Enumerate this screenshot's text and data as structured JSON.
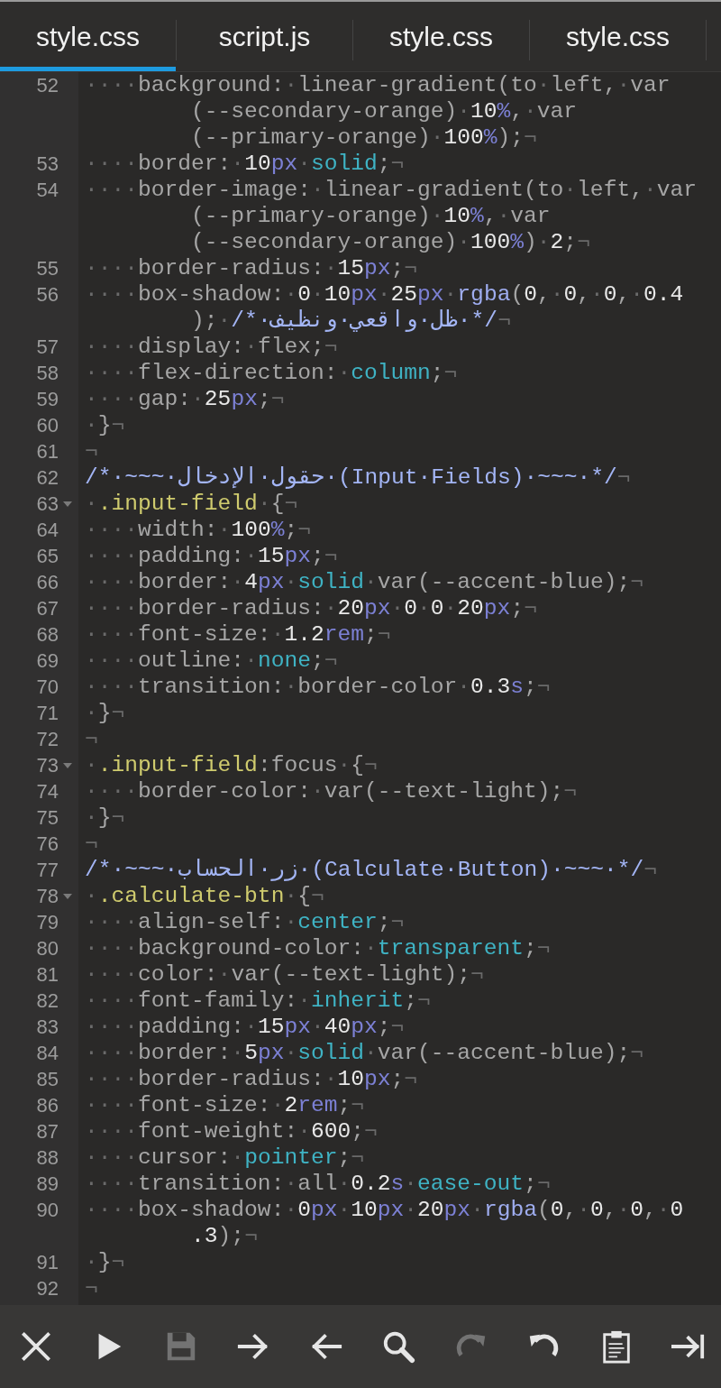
{
  "tabs": [
    {
      "label": "style.css",
      "selected": true
    },
    {
      "label": "script.js",
      "selected": false
    },
    {
      "label": "style.css",
      "selected": false
    },
    {
      "label": "style.css",
      "selected": false
    }
  ],
  "lines": [
    {
      "number": "52",
      "fold": false,
      "rows": [
        {
          "tokens": [
            {
              "kind": "ws",
              "text": "····"
            },
            {
              "kind": "p",
              "text": "background:"
            },
            {
              "kind": "ws",
              "text": "·"
            },
            {
              "kind": "p",
              "text": "linear-gradient(to"
            },
            {
              "kind": "ws",
              "text": "·"
            },
            {
              "kind": "p",
              "text": "left,"
            },
            {
              "kind": "ws",
              "text": "·"
            },
            {
              "kind": "p",
              "text": "var"
            }
          ]
        },
        {
          "tokens": [
            {
              "kind": "p",
              "text": "(--secondary-orange)"
            },
            {
              "kind": "ws",
              "text": "·"
            },
            {
              "kind": "n",
              "text": "10"
            },
            {
              "kind": "u",
              "text": "%"
            },
            {
              "kind": "p",
              "text": ","
            },
            {
              "kind": "ws",
              "text": "·"
            },
            {
              "kind": "p",
              "text": "var"
            }
          ]
        },
        {
          "tokens": [
            {
              "kind": "p",
              "text": "(--primary-orange)"
            },
            {
              "kind": "ws",
              "text": "·"
            },
            {
              "kind": "n",
              "text": "100"
            },
            {
              "kind": "u",
              "text": "%"
            },
            {
              "kind": "p",
              "text": ");"
            },
            {
              "kind": "ws",
              "text": "¬"
            }
          ]
        }
      ]
    },
    {
      "number": "53",
      "fold": false,
      "rows": [
        {
          "tokens": [
            {
              "kind": "ws",
              "text": "····"
            },
            {
              "kind": "p",
              "text": "border:"
            },
            {
              "kind": "ws",
              "text": "·"
            },
            {
              "kind": "n",
              "text": "10"
            },
            {
              "kind": "u",
              "text": "px"
            },
            {
              "kind": "ws",
              "text": "·"
            },
            {
              "kind": "k",
              "text": "solid"
            },
            {
              "kind": "p",
              "text": ";"
            },
            {
              "kind": "ws",
              "text": "¬"
            }
          ]
        }
      ]
    },
    {
      "number": "54",
      "fold": false,
      "rows": [
        {
          "tokens": [
            {
              "kind": "ws",
              "text": "····"
            },
            {
              "kind": "p",
              "text": "border-image:"
            },
            {
              "kind": "ws",
              "text": "·"
            },
            {
              "kind": "p",
              "text": "linear-gradient(to"
            },
            {
              "kind": "ws",
              "text": "·"
            },
            {
              "kind": "p",
              "text": "left,"
            },
            {
              "kind": "ws",
              "text": "·"
            },
            {
              "kind": "p",
              "text": "var"
            }
          ]
        },
        {
          "tokens": [
            {
              "kind": "p",
              "text": "(--primary-orange)"
            },
            {
              "kind": "ws",
              "text": "·"
            },
            {
              "kind": "n",
              "text": "10"
            },
            {
              "kind": "u",
              "text": "%"
            },
            {
              "kind": "p",
              "text": ","
            },
            {
              "kind": "ws",
              "text": "·"
            },
            {
              "kind": "p",
              "text": "var"
            }
          ]
        },
        {
          "tokens": [
            {
              "kind": "p",
              "text": "(--secondary-orange)"
            },
            {
              "kind": "ws",
              "text": "·"
            },
            {
              "kind": "n",
              "text": "100"
            },
            {
              "kind": "u",
              "text": "%"
            },
            {
              "kind": "p",
              "text": ")"
            },
            {
              "kind": "ws",
              "text": "·"
            },
            {
              "kind": "n",
              "text": "2"
            },
            {
              "kind": "p",
              "text": ";"
            },
            {
              "kind": "ws",
              "text": "¬"
            }
          ]
        }
      ]
    },
    {
      "number": "55",
      "fold": false,
      "rows": [
        {
          "tokens": [
            {
              "kind": "ws",
              "text": "····"
            },
            {
              "kind": "p",
              "text": "border-radius:"
            },
            {
              "kind": "ws",
              "text": "·"
            },
            {
              "kind": "n",
              "text": "15"
            },
            {
              "kind": "u",
              "text": "px"
            },
            {
              "kind": "p",
              "text": ";"
            },
            {
              "kind": "ws",
              "text": "¬"
            }
          ]
        }
      ]
    },
    {
      "number": "56",
      "fold": false,
      "rows": [
        {
          "tokens": [
            {
              "kind": "ws",
              "text": "····"
            },
            {
              "kind": "p",
              "text": "box-shadow:"
            },
            {
              "kind": "ws",
              "text": "·"
            },
            {
              "kind": "n",
              "text": "0"
            },
            {
              "kind": "ws",
              "text": "·"
            },
            {
              "kind": "n",
              "text": "10"
            },
            {
              "kind": "u",
              "text": "px"
            },
            {
              "kind": "ws",
              "text": "·"
            },
            {
              "kind": "n",
              "text": "25"
            },
            {
              "kind": "u",
              "text": "px"
            },
            {
              "kind": "ws",
              "text": "·"
            },
            {
              "kind": "f",
              "text": "rgba"
            },
            {
              "kind": "p",
              "text": "("
            },
            {
              "kind": "n",
              "text": "0"
            },
            {
              "kind": "p",
              "text": ","
            },
            {
              "kind": "ws",
              "text": "·"
            },
            {
              "kind": "n",
              "text": "0"
            },
            {
              "kind": "p",
              "text": ","
            },
            {
              "kind": "ws",
              "text": "·"
            },
            {
              "kind": "n",
              "text": "0"
            },
            {
              "kind": "p",
              "text": ","
            },
            {
              "kind": "ws",
              "text": "·"
            },
            {
              "kind": "n",
              "text": "0.4"
            }
          ]
        },
        {
          "tokens": [
            {
              "kind": "p",
              "text": ");"
            },
            {
              "kind": "ws",
              "text": "·"
            },
            {
              "kind": "c",
              "text": "/*·ظل·واقعي·ونظيف·*/"
            },
            {
              "kind": "ws",
              "text": "¬"
            }
          ]
        }
      ]
    },
    {
      "number": "57",
      "fold": false,
      "rows": [
        {
          "tokens": [
            {
              "kind": "ws",
              "text": "····"
            },
            {
              "kind": "p",
              "text": "display:"
            },
            {
              "kind": "ws",
              "text": "·"
            },
            {
              "kind": "p",
              "text": "flex;"
            },
            {
              "kind": "ws",
              "text": "¬"
            }
          ]
        }
      ]
    },
    {
      "number": "58",
      "fold": false,
      "rows": [
        {
          "tokens": [
            {
              "kind": "ws",
              "text": "····"
            },
            {
              "kind": "p",
              "text": "flex-direction:"
            },
            {
              "kind": "ws",
              "text": "·"
            },
            {
              "kind": "k",
              "text": "column"
            },
            {
              "kind": "p",
              "text": ";"
            },
            {
              "kind": "ws",
              "text": "¬"
            }
          ]
        }
      ]
    },
    {
      "number": "59",
      "fold": false,
      "rows": [
        {
          "tokens": [
            {
              "kind": "ws",
              "text": "····"
            },
            {
              "kind": "p",
              "text": "gap:"
            },
            {
              "kind": "ws",
              "text": "·"
            },
            {
              "kind": "n",
              "text": "25"
            },
            {
              "kind": "u",
              "text": "px"
            },
            {
              "kind": "p",
              "text": ";"
            },
            {
              "kind": "ws",
              "text": "¬"
            }
          ]
        }
      ]
    },
    {
      "number": "60",
      "fold": false,
      "rows": [
        {
          "tokens": [
            {
              "kind": "ws",
              "text": "·"
            },
            {
              "kind": "p",
              "text": "}"
            },
            {
              "kind": "ws",
              "text": "¬"
            }
          ]
        }
      ]
    },
    {
      "number": "61",
      "fold": false,
      "rows": [
        {
          "tokens": [
            {
              "kind": "ws",
              "text": "¬"
            }
          ]
        }
      ]
    },
    {
      "number": "62",
      "fold": false,
      "rows": [
        {
          "tokens": [
            {
              "kind": "c",
              "text": "/*·~~~·حقول·الإدخال·(Input·Fields)·~~~·*/"
            },
            {
              "kind": "ws",
              "text": "¬"
            }
          ]
        }
      ]
    },
    {
      "number": "63",
      "fold": true,
      "rows": [
        {
          "tokens": [
            {
              "kind": "ws",
              "text": "·"
            },
            {
              "kind": "s",
              "text": ".input-field"
            },
            {
              "kind": "ws",
              "text": "·"
            },
            {
              "kind": "p",
              "text": "{"
            },
            {
              "kind": "ws",
              "text": "¬"
            }
          ]
        }
      ]
    },
    {
      "number": "64",
      "fold": false,
      "rows": [
        {
          "tokens": [
            {
              "kind": "ws",
              "text": "····"
            },
            {
              "kind": "p",
              "text": "width:"
            },
            {
              "kind": "ws",
              "text": "·"
            },
            {
              "kind": "n",
              "text": "100"
            },
            {
              "kind": "u",
              "text": "%"
            },
            {
              "kind": "p",
              "text": ";"
            },
            {
              "kind": "ws",
              "text": "¬"
            }
          ]
        }
      ]
    },
    {
      "number": "65",
      "fold": false,
      "rows": [
        {
          "tokens": [
            {
              "kind": "ws",
              "text": "····"
            },
            {
              "kind": "p",
              "text": "padding:"
            },
            {
              "kind": "ws",
              "text": "·"
            },
            {
              "kind": "n",
              "text": "15"
            },
            {
              "kind": "u",
              "text": "px"
            },
            {
              "kind": "p",
              "text": ";"
            },
            {
              "kind": "ws",
              "text": "¬"
            }
          ]
        }
      ]
    },
    {
      "number": "66",
      "fold": false,
      "rows": [
        {
          "tokens": [
            {
              "kind": "ws",
              "text": "····"
            },
            {
              "kind": "p",
              "text": "border:"
            },
            {
              "kind": "ws",
              "text": "·"
            },
            {
              "kind": "n",
              "text": "4"
            },
            {
              "kind": "u",
              "text": "px"
            },
            {
              "kind": "ws",
              "text": "·"
            },
            {
              "kind": "k",
              "text": "solid"
            },
            {
              "kind": "ws",
              "text": "·"
            },
            {
              "kind": "p",
              "text": "var(--accent-blue);"
            },
            {
              "kind": "ws",
              "text": "¬"
            }
          ]
        }
      ]
    },
    {
      "number": "67",
      "fold": false,
      "rows": [
        {
          "tokens": [
            {
              "kind": "ws",
              "text": "····"
            },
            {
              "kind": "p",
              "text": "border-radius:"
            },
            {
              "kind": "ws",
              "text": "·"
            },
            {
              "kind": "n",
              "text": "20"
            },
            {
              "kind": "u",
              "text": "px"
            },
            {
              "kind": "ws",
              "text": "·"
            },
            {
              "kind": "n",
              "text": "0"
            },
            {
              "kind": "ws",
              "text": "·"
            },
            {
              "kind": "n",
              "text": "0"
            },
            {
              "kind": "ws",
              "text": "·"
            },
            {
              "kind": "n",
              "text": "20"
            },
            {
              "kind": "u",
              "text": "px"
            },
            {
              "kind": "p",
              "text": ";"
            },
            {
              "kind": "ws",
              "text": "¬"
            }
          ]
        }
      ]
    },
    {
      "number": "68",
      "fold": false,
      "rows": [
        {
          "tokens": [
            {
              "kind": "ws",
              "text": "····"
            },
            {
              "kind": "p",
              "text": "font-size:"
            },
            {
              "kind": "ws",
              "text": "·"
            },
            {
              "kind": "n",
              "text": "1.2"
            },
            {
              "kind": "u",
              "text": "rem"
            },
            {
              "kind": "p",
              "text": ";"
            },
            {
              "kind": "ws",
              "text": "¬"
            }
          ]
        }
      ]
    },
    {
      "number": "69",
      "fold": false,
      "rows": [
        {
          "tokens": [
            {
              "kind": "ws",
              "text": "····"
            },
            {
              "kind": "p",
              "text": "outline:"
            },
            {
              "kind": "ws",
              "text": "·"
            },
            {
              "kind": "k",
              "text": "none"
            },
            {
              "kind": "p",
              "text": ";"
            },
            {
              "kind": "ws",
              "text": "¬"
            }
          ]
        }
      ]
    },
    {
      "number": "70",
      "fold": false,
      "rows": [
        {
          "tokens": [
            {
              "kind": "ws",
              "text": "····"
            },
            {
              "kind": "p",
              "text": "transition:"
            },
            {
              "kind": "ws",
              "text": "·"
            },
            {
              "kind": "p",
              "text": "border-color"
            },
            {
              "kind": "ws",
              "text": "·"
            },
            {
              "kind": "n",
              "text": "0.3"
            },
            {
              "kind": "u",
              "text": "s"
            },
            {
              "kind": "p",
              "text": ";"
            },
            {
              "kind": "ws",
              "text": "¬"
            }
          ]
        }
      ]
    },
    {
      "number": "71",
      "fold": false,
      "rows": [
        {
          "tokens": [
            {
              "kind": "ws",
              "text": "·"
            },
            {
              "kind": "p",
              "text": "}"
            },
            {
              "kind": "ws",
              "text": "¬"
            }
          ]
        }
      ]
    },
    {
      "number": "72",
      "fold": false,
      "rows": [
        {
          "tokens": [
            {
              "kind": "ws",
              "text": "¬"
            }
          ]
        }
      ]
    },
    {
      "number": "73",
      "fold": true,
      "rows": [
        {
          "tokens": [
            {
              "kind": "ws",
              "text": "·"
            },
            {
              "kind": "s",
              "text": ".input-field"
            },
            {
              "kind": "p",
              "text": ":focus"
            },
            {
              "kind": "ws",
              "text": "·"
            },
            {
              "kind": "p",
              "text": "{"
            },
            {
              "kind": "ws",
              "text": "¬"
            }
          ]
        }
      ]
    },
    {
      "number": "74",
      "fold": false,
      "rows": [
        {
          "tokens": [
            {
              "kind": "ws",
              "text": "····"
            },
            {
              "kind": "p",
              "text": "border-color:"
            },
            {
              "kind": "ws",
              "text": "·"
            },
            {
              "kind": "p",
              "text": "var(--text-light);"
            },
            {
              "kind": "ws",
              "text": "¬"
            }
          ]
        }
      ]
    },
    {
      "number": "75",
      "fold": false,
      "rows": [
        {
          "tokens": [
            {
              "kind": "ws",
              "text": "·"
            },
            {
              "kind": "p",
              "text": "}"
            },
            {
              "kind": "ws",
              "text": "¬"
            }
          ]
        }
      ]
    },
    {
      "number": "76",
      "fold": false,
      "rows": [
        {
          "tokens": [
            {
              "kind": "ws",
              "text": "¬"
            }
          ]
        }
      ]
    },
    {
      "number": "77",
      "fold": false,
      "rows": [
        {
          "tokens": [
            {
              "kind": "c",
              "text": "/*·~~~·زر·الحساب·(Calculate·Button)·~~~·*/"
            },
            {
              "kind": "ws",
              "text": "¬"
            }
          ]
        }
      ]
    },
    {
      "number": "78",
      "fold": true,
      "rows": [
        {
          "tokens": [
            {
              "kind": "ws",
              "text": "·"
            },
            {
              "kind": "s",
              "text": ".calculate-btn"
            },
            {
              "kind": "ws",
              "text": "·"
            },
            {
              "kind": "p",
              "text": "{"
            },
            {
              "kind": "ws",
              "text": "¬"
            }
          ]
        }
      ]
    },
    {
      "number": "79",
      "fold": false,
      "rows": [
        {
          "tokens": [
            {
              "kind": "ws",
              "text": "····"
            },
            {
              "kind": "p",
              "text": "align-self:"
            },
            {
              "kind": "ws",
              "text": "·"
            },
            {
              "kind": "k",
              "text": "center"
            },
            {
              "kind": "p",
              "text": ";"
            },
            {
              "kind": "ws",
              "text": "¬"
            }
          ]
        }
      ]
    },
    {
      "number": "80",
      "fold": false,
      "rows": [
        {
          "tokens": [
            {
              "kind": "ws",
              "text": "····"
            },
            {
              "kind": "p",
              "text": "background-color:"
            },
            {
              "kind": "ws",
              "text": "·"
            },
            {
              "kind": "k",
              "text": "transparent"
            },
            {
              "kind": "p",
              "text": ";"
            },
            {
              "kind": "ws",
              "text": "¬"
            }
          ]
        }
      ]
    },
    {
      "number": "81",
      "fold": false,
      "rows": [
        {
          "tokens": [
            {
              "kind": "ws",
              "text": "····"
            },
            {
              "kind": "p",
              "text": "color:"
            },
            {
              "kind": "ws",
              "text": "·"
            },
            {
              "kind": "p",
              "text": "var(--text-light);"
            },
            {
              "kind": "ws",
              "text": "¬"
            }
          ]
        }
      ]
    },
    {
      "number": "82",
      "fold": false,
      "rows": [
        {
          "tokens": [
            {
              "kind": "ws",
              "text": "····"
            },
            {
              "kind": "p",
              "text": "font-family:"
            },
            {
              "kind": "ws",
              "text": "·"
            },
            {
              "kind": "k",
              "text": "inherit"
            },
            {
              "kind": "p",
              "text": ";"
            },
            {
              "kind": "ws",
              "text": "¬"
            }
          ]
        }
      ]
    },
    {
      "number": "83",
      "fold": false,
      "rows": [
        {
          "tokens": [
            {
              "kind": "ws",
              "text": "····"
            },
            {
              "kind": "p",
              "text": "padding:"
            },
            {
              "kind": "ws",
              "text": "·"
            },
            {
              "kind": "n",
              "text": "15"
            },
            {
              "kind": "u",
              "text": "px"
            },
            {
              "kind": "ws",
              "text": "·"
            },
            {
              "kind": "n",
              "text": "40"
            },
            {
              "kind": "u",
              "text": "px"
            },
            {
              "kind": "p",
              "text": ";"
            },
            {
              "kind": "ws",
              "text": "¬"
            }
          ]
        }
      ]
    },
    {
      "number": "84",
      "fold": false,
      "rows": [
        {
          "tokens": [
            {
              "kind": "ws",
              "text": "····"
            },
            {
              "kind": "p",
              "text": "border:"
            },
            {
              "kind": "ws",
              "text": "·"
            },
            {
              "kind": "n",
              "text": "5"
            },
            {
              "kind": "u",
              "text": "px"
            },
            {
              "kind": "ws",
              "text": "·"
            },
            {
              "kind": "k",
              "text": "solid"
            },
            {
              "kind": "ws",
              "text": "·"
            },
            {
              "kind": "p",
              "text": "var(--accent-blue);"
            },
            {
              "kind": "ws",
              "text": "¬"
            }
          ]
        }
      ]
    },
    {
      "number": "85",
      "fold": false,
      "rows": [
        {
          "tokens": [
            {
              "kind": "ws",
              "text": "····"
            },
            {
              "kind": "p",
              "text": "border-radius:"
            },
            {
              "kind": "ws",
              "text": "·"
            },
            {
              "kind": "n",
              "text": "10"
            },
            {
              "kind": "u",
              "text": "px"
            },
            {
              "kind": "p",
              "text": ";"
            },
            {
              "kind": "ws",
              "text": "¬"
            }
          ]
        }
      ]
    },
    {
      "number": "86",
      "fold": false,
      "rows": [
        {
          "tokens": [
            {
              "kind": "ws",
              "text": "····"
            },
            {
              "kind": "p",
              "text": "font-size:"
            },
            {
              "kind": "ws",
              "text": "·"
            },
            {
              "kind": "n",
              "text": "2"
            },
            {
              "kind": "u",
              "text": "rem"
            },
            {
              "kind": "p",
              "text": ";"
            },
            {
              "kind": "ws",
              "text": "¬"
            }
          ]
        }
      ]
    },
    {
      "number": "87",
      "fold": false,
      "rows": [
        {
          "tokens": [
            {
              "kind": "ws",
              "text": "····"
            },
            {
              "kind": "p",
              "text": "font-weight:"
            },
            {
              "kind": "ws",
              "text": "·"
            },
            {
              "kind": "n",
              "text": "600"
            },
            {
              "kind": "p",
              "text": ";"
            },
            {
              "kind": "ws",
              "text": "¬"
            }
          ]
        }
      ]
    },
    {
      "number": "88",
      "fold": false,
      "rows": [
        {
          "tokens": [
            {
              "kind": "ws",
              "text": "····"
            },
            {
              "kind": "p",
              "text": "cursor:"
            },
            {
              "kind": "ws",
              "text": "·"
            },
            {
              "kind": "k",
              "text": "pointer"
            },
            {
              "kind": "p",
              "text": ";"
            },
            {
              "kind": "ws",
              "text": "¬"
            }
          ]
        }
      ]
    },
    {
      "number": "89",
      "fold": false,
      "rows": [
        {
          "tokens": [
            {
              "kind": "ws",
              "text": "····"
            },
            {
              "kind": "p",
              "text": "transition:"
            },
            {
              "kind": "ws",
              "text": "·"
            },
            {
              "kind": "p",
              "text": "all"
            },
            {
              "kind": "ws",
              "text": "·"
            },
            {
              "kind": "n",
              "text": "0.2"
            },
            {
              "kind": "u",
              "text": "s"
            },
            {
              "kind": "ws",
              "text": "·"
            },
            {
              "kind": "k",
              "text": "ease-out"
            },
            {
              "kind": "p",
              "text": ";"
            },
            {
              "kind": "ws",
              "text": "¬"
            }
          ]
        }
      ]
    },
    {
      "number": "90",
      "fold": false,
      "rows": [
        {
          "tokens": [
            {
              "kind": "ws",
              "text": "····"
            },
            {
              "kind": "p",
              "text": "box-shadow:"
            },
            {
              "kind": "ws",
              "text": "·"
            },
            {
              "kind": "n",
              "text": "0"
            },
            {
              "kind": "u",
              "text": "px"
            },
            {
              "kind": "ws",
              "text": "·"
            },
            {
              "kind": "n",
              "text": "10"
            },
            {
              "kind": "u",
              "text": "px"
            },
            {
              "kind": "ws",
              "text": "·"
            },
            {
              "kind": "n",
              "text": "20"
            },
            {
              "kind": "u",
              "text": "px"
            },
            {
              "kind": "ws",
              "text": "·"
            },
            {
              "kind": "f",
              "text": "rgba"
            },
            {
              "kind": "p",
              "text": "("
            },
            {
              "kind": "n",
              "text": "0"
            },
            {
              "kind": "p",
              "text": ","
            },
            {
              "kind": "ws",
              "text": "·"
            },
            {
              "kind": "n",
              "text": "0"
            },
            {
              "kind": "p",
              "text": ","
            },
            {
              "kind": "ws",
              "text": "·"
            },
            {
              "kind": "n",
              "text": "0"
            },
            {
              "kind": "p",
              "text": ","
            },
            {
              "kind": "ws",
              "text": "·"
            },
            {
              "kind": "n",
              "text": "0"
            }
          ]
        },
        {
          "tokens": [
            {
              "kind": "n",
              "text": ".3"
            },
            {
              "kind": "p",
              "text": ");"
            },
            {
              "kind": "ws",
              "text": "¬"
            }
          ]
        }
      ]
    },
    {
      "number": "91",
      "fold": false,
      "rows": [
        {
          "tokens": [
            {
              "kind": "ws",
              "text": "·"
            },
            {
              "kind": "p",
              "text": "}"
            },
            {
              "kind": "ws",
              "text": "¬"
            }
          ]
        }
      ]
    },
    {
      "number": "92",
      "fold": false,
      "rows": [
        {
          "tokens": [
            {
              "kind": "ws",
              "text": "¬"
            }
          ]
        }
      ]
    }
  ],
  "toolbar": [
    {
      "kind": "close",
      "disabled": false
    },
    {
      "kind": "run",
      "disabled": false
    },
    {
      "kind": "save",
      "disabled": true
    },
    {
      "kind": "forward",
      "disabled": false
    },
    {
      "kind": "back",
      "disabled": false
    },
    {
      "kind": "search",
      "disabled": false
    },
    {
      "kind": "redo",
      "disabled": true
    },
    {
      "kind": "undo",
      "disabled": false
    },
    {
      "kind": "clipboard",
      "disabled": false
    },
    {
      "kind": "tab-end",
      "disabled": false
    }
  ]
}
